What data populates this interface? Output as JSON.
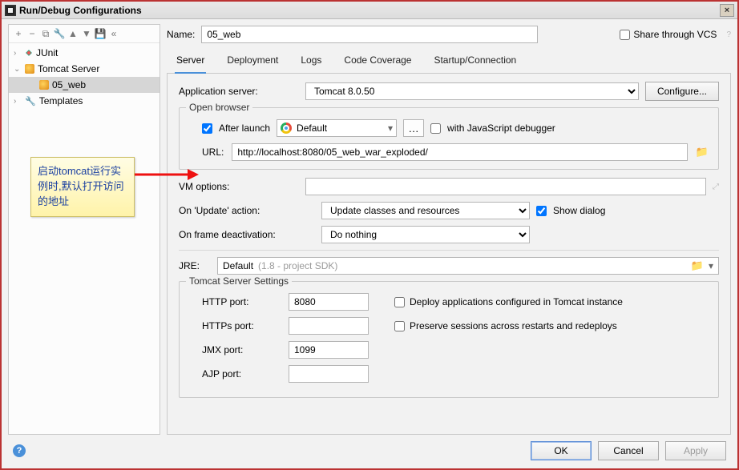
{
  "window": {
    "title": "Run/Debug Configurations"
  },
  "toolbar": {
    "add": "+",
    "remove": "−",
    "copy": "⧉",
    "wrench": "🔧",
    "up": "▲",
    "down": "▼",
    "save": "💾",
    "collapse": "«"
  },
  "tree": {
    "junit": "JUnit",
    "tomcat": "Tomcat Server",
    "item": "05_web",
    "templates": "Templates"
  },
  "name_label": "Name:",
  "name_value": "05_web",
  "share_label": "Share through VCS",
  "tabs": {
    "server": "Server",
    "deployment": "Deployment",
    "logs": "Logs",
    "coverage": "Code Coverage",
    "startup": "Startup/Connection"
  },
  "app_server": {
    "label": "Application server:",
    "value": "Tomcat 8.0.50",
    "configure": "Configure..."
  },
  "open_browser": {
    "legend": "Open browser",
    "after_launch": "After launch",
    "browser": "Default",
    "js_debugger_label": "with JavaScript debugger",
    "url_label": "URL:",
    "url": "http://localhost:8080/05_web_war_exploded/"
  },
  "vm_label": "VM options:",
  "on_update": {
    "label": "On 'Update' action:",
    "value": "Update classes and resources",
    "show_dialog": "Show dialog"
  },
  "on_frame": {
    "label": "On frame deactivation:",
    "value": "Do nothing"
  },
  "jre": {
    "label": "JRE:",
    "value": "Default",
    "hint": "(1.8 - project SDK)"
  },
  "ports": {
    "legend": "Tomcat Server Settings",
    "http_label": "HTTP port:",
    "http": "8080",
    "https_label": "HTTPs port:",
    "https": "",
    "jmx_label": "JMX port:",
    "jmx": "1099",
    "ajp_label": "AJP port:",
    "ajp": "",
    "deploy_cfg": "Deploy applications configured in Tomcat instance",
    "preserve": "Preserve sessions across restarts and redeploys"
  },
  "footer": {
    "ok": "OK",
    "cancel": "Cancel",
    "apply": "Apply"
  },
  "annotation": "启动tomcat运行实例时,默认打开访问的地址"
}
